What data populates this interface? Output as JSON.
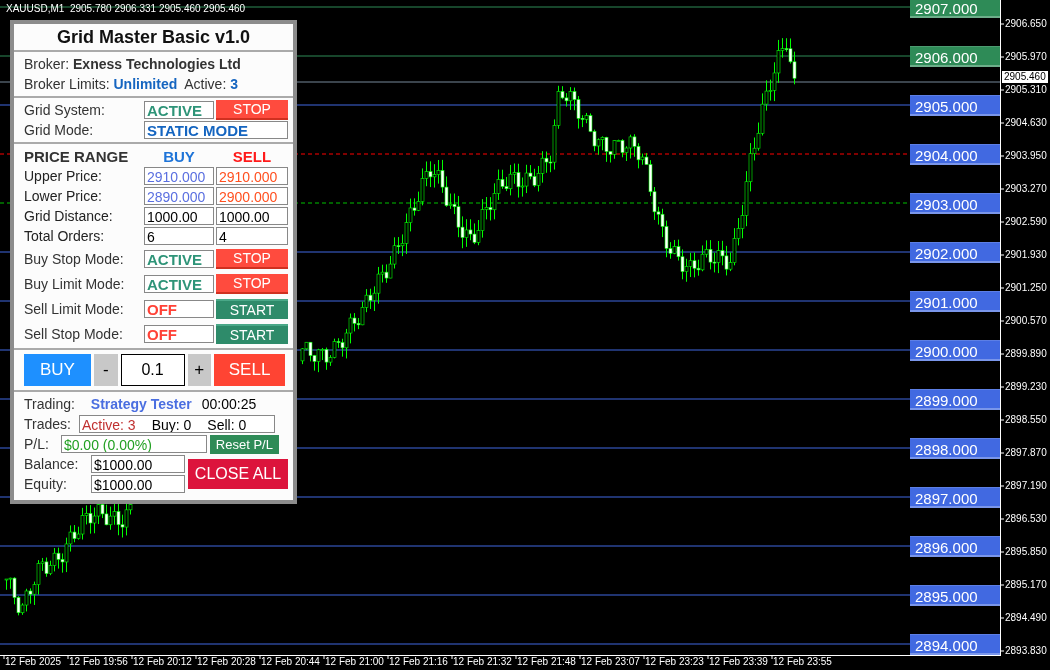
{
  "chart_header": {
    "text": "XAUUSD,M1  2905.780 2906.331 2905.460 2905.460"
  },
  "panel": {
    "title": "Grid Master Basic v1.0",
    "broker": {
      "label": "Broker:",
      "value": "Exness Technologies Ltd"
    },
    "broker_limits": {
      "label": "Broker Limits:",
      "value": "Unlimited",
      "active_label": "Active:",
      "active_value": "3"
    },
    "grid_system": {
      "label": "Grid System:",
      "status": "ACTIVE",
      "on": true,
      "button": "STOP"
    },
    "grid_mode": {
      "label": "Grid Mode:",
      "value": "STATIC MODE"
    },
    "price_range": {
      "title": "PRICE RANGE",
      "buy_header": "BUY",
      "sell_header": "SELL",
      "rows": [
        {
          "label": "Upper Price:",
          "kind": "price",
          "buy": "2910.000",
          "sell": "2910.000"
        },
        {
          "label": "Lower Price:",
          "kind": "price",
          "buy": "2890.000",
          "sell": "2900.000"
        },
        {
          "label": "Grid Distance:",
          "kind": "number",
          "buy": "1000.00",
          "sell": "1000.00"
        },
        {
          "label": "Total Orders:",
          "kind": "number",
          "buy": "6",
          "sell": "4"
        }
      ]
    },
    "modes": [
      {
        "label": "Buy Stop Mode:",
        "status": "ACTIVE",
        "on": true,
        "button": "STOP"
      },
      {
        "label": "Buy Limit Mode:",
        "status": "ACTIVE",
        "on": true,
        "button": "STOP"
      },
      {
        "label": "Sell Limit Mode:",
        "status": "OFF",
        "on": false,
        "button": "START"
      },
      {
        "label": "Sell Stop Mode:",
        "status": "OFF",
        "on": false,
        "button": "START"
      }
    ],
    "order": {
      "buy": "BUY",
      "minus": "-",
      "lot": "0.1",
      "plus": "+",
      "sell": "SELL"
    },
    "trading": {
      "label": "Trading:",
      "value": "Strategy Tester",
      "timer": "00:00:25"
    },
    "trades": {
      "label": "Trades:",
      "active": "Active: 3",
      "buy": "Buy: 0",
      "sell": "Sell: 0"
    },
    "pl": {
      "label": "P/L:",
      "value": "$0.00 (0.00%)",
      "button": "Reset P/L"
    },
    "balance": {
      "label": "Balance:",
      "value": "$1000.00"
    },
    "equity": {
      "label": "Equity:",
      "value": "$1000.00"
    },
    "close_all": "CLOSE ALL"
  },
  "grid_levels": [
    {
      "price": "2907.000",
      "color": "#2e8b57",
      "kind": "plain"
    },
    {
      "price": "2906.000",
      "color": "#2e8b57",
      "kind": "plain"
    },
    {
      "price": "2905.000",
      "color": "#4169e1",
      "kind": "plain"
    },
    {
      "price": "2904.000",
      "color": "#4169e1",
      "kind": "sell-order"
    },
    {
      "price": "2903.000",
      "color": "#4169e1",
      "kind": "buy-order"
    },
    {
      "price": "2902.000",
      "color": "#4169e1",
      "kind": "plain"
    },
    {
      "price": "2901.000",
      "color": "#4169e1",
      "kind": "plain"
    },
    {
      "price": "2900.000",
      "color": "#4169e1",
      "kind": "plain"
    },
    {
      "price": "2899.000",
      "color": "#4169e1",
      "kind": "plain"
    },
    {
      "price": "2898.000",
      "color": "#4169e1",
      "kind": "plain"
    },
    {
      "price": "2897.000",
      "color": "#4169e1",
      "kind": "plain"
    },
    {
      "price": "2896.000",
      "color": "#4169e1",
      "kind": "plain"
    },
    {
      "price": "2895.000",
      "color": "#4169e1",
      "kind": "plain"
    },
    {
      "price": "2894.000",
      "color": "#4169e1",
      "kind": "plain"
    }
  ],
  "price_axis": {
    "current": "2905.460",
    "ticks": [
      "2906.650",
      "2905.970",
      "2905.310",
      "2904.630",
      "2903.950",
      "2903.270",
      "2902.590",
      "2901.930",
      "2901.250",
      "2900.570",
      "2899.890",
      "2899.230",
      "2898.550",
      "2897.870",
      "2897.190",
      "2896.530",
      "2895.850",
      "2895.170",
      "2894.490",
      "2893.830"
    ]
  },
  "time_axis": {
    "ticks": [
      "12 Feb 2025",
      "12 Feb 19:56",
      "12 Feb 20:12",
      "12 Feb 20:28",
      "12 Feb 20:44",
      "12 Feb 21:00",
      "12 Feb 21:16",
      "12 Feb 21:32",
      "12 Feb 21:48",
      "12 Feb 23:07",
      "12 Feb 23:23",
      "12 Feb 23:39",
      "12 Feb 23:55"
    ]
  }
}
